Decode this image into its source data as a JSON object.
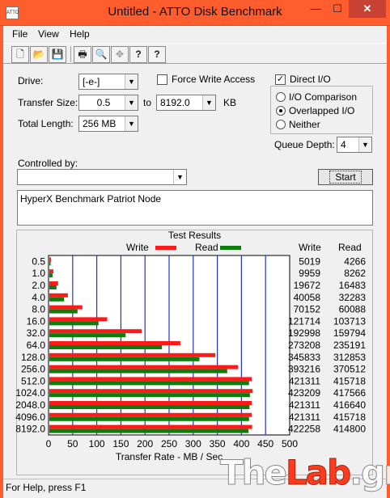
{
  "window": {
    "title": "Untitled - ATTO Disk Benchmark",
    "app_icon_label": "ATTO",
    "min_glyph": "—",
    "max_glyph": "☐",
    "close_glyph": "✕"
  },
  "menu": [
    "File",
    "View",
    "Help"
  ],
  "toolbar": {
    "icons": [
      "new-icon",
      "open-icon",
      "save-icon",
      "print-icon",
      "print-preview-icon",
      "move-icon",
      "help-icon",
      "context-help-icon"
    ],
    "glyphs": [
      "🗋",
      "📂",
      "💾",
      "🖶",
      "🔍",
      "✥",
      "?",
      "?"
    ]
  },
  "settings": {
    "drive_label": "Drive:",
    "drive_value": "[-e-]",
    "force_write_label": "Force Write Access",
    "force_write_checked": false,
    "transfer_size_label": "Transfer Size:",
    "transfer_from": "0.5",
    "to_label": "to",
    "transfer_to": "8192.0",
    "kb_label": "KB",
    "total_length_label": "Total Length:",
    "total_length_value": "256 MB",
    "direct_io_label": "Direct I/O",
    "direct_io_checked": true,
    "io_options": [
      "I/O Comparison",
      "Overlapped I/O",
      "Neither"
    ],
    "io_selected": "Overlapped I/O",
    "queue_depth_label": "Queue Depth:",
    "queue_depth_value": "4",
    "controlled_by_label": "Controlled by:",
    "controlled_by_value": "",
    "start_label": "Start",
    "description": "HyperX Benchmark Patriot Node"
  },
  "results": {
    "title": "Test Results",
    "write_legend": "Write",
    "read_legend": "Read",
    "write_col": "Write",
    "read_col": "Read"
  },
  "chart_data": {
    "type": "bar",
    "orientation": "horizontal",
    "title": "Test Results",
    "xlabel": "Transfer Rate - MB / Sec",
    "xlim": [
      0,
      500
    ],
    "xticks": [
      0,
      50,
      100,
      150,
      200,
      250,
      300,
      350,
      400,
      450,
      500
    ],
    "categories": [
      "0.5",
      "1.0",
      "2.0",
      "4.0",
      "8.0",
      "16.0",
      "32.0",
      "64.0",
      "128.0",
      "256.0",
      "512.0",
      "1024.0",
      "2048.0",
      "4096.0",
      "8192.0"
    ],
    "series": [
      {
        "name": "Write",
        "color": "#ff1a1a",
        "values": [
          5019,
          9959,
          19672,
          40058,
          70152,
          121714,
          192998,
          273208,
          345833,
          393216,
          421311,
          423209,
          421311,
          421311,
          422258
        ]
      },
      {
        "name": "Read",
        "color": "#0c7d0c",
        "values": [
          4266,
          8262,
          16483,
          32283,
          60088,
          103713,
          159794,
          235191,
          312853,
          370512,
          415718,
          417566,
          416640,
          415718,
          414800
        ]
      }
    ],
    "value_unit_divisor": 1000,
    "grid": true,
    "legend": "top"
  },
  "status": {
    "text": "For Help, press F1"
  },
  "watermark": {
    "part1": "The",
    "part2": "Lab",
    "part3": ".gr"
  }
}
